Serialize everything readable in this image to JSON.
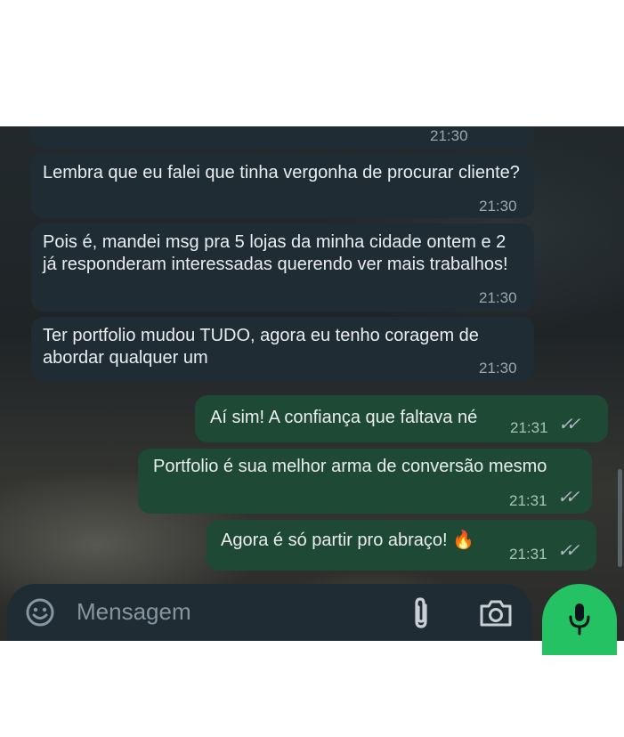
{
  "messages": {
    "cut_time": "21:30",
    "incoming": [
      {
        "text": "Lembra que eu falei que tinha vergonha de procurar cliente?",
        "time": "21:30"
      },
      {
        "text": "Pois é, mandei msg pra 5 lojas da minha cidade ontem e 2 já responderam interessadas querendo ver mais trabalhos!",
        "time": "21:30"
      },
      {
        "text": "Ter portfolio mudou TUDO, agora eu tenho coragem de abordar qualquer um",
        "time": "21:30"
      }
    ],
    "outgoing": [
      {
        "text": "Aí sim! A confiança que faltava né",
        "time": "21:31",
        "status": "read"
      },
      {
        "text": "Portfolio é sua melhor arma de conversão mesmo",
        "time": "21:31",
        "status": "read"
      },
      {
        "text": "Agora é só partir pro abraço! 🔥",
        "time": "21:31",
        "status": "read"
      }
    ]
  },
  "composer": {
    "placeholder": "Mensagem",
    "icons": [
      "sticker-icon",
      "attach-icon",
      "camera-icon",
      "mic-icon"
    ]
  },
  "colors": {
    "incoming_bubble": "#202c33",
    "outgoing_bubble": "#1e4a35",
    "mic_button": "#25c263",
    "input_bar": "#1f2c33"
  }
}
